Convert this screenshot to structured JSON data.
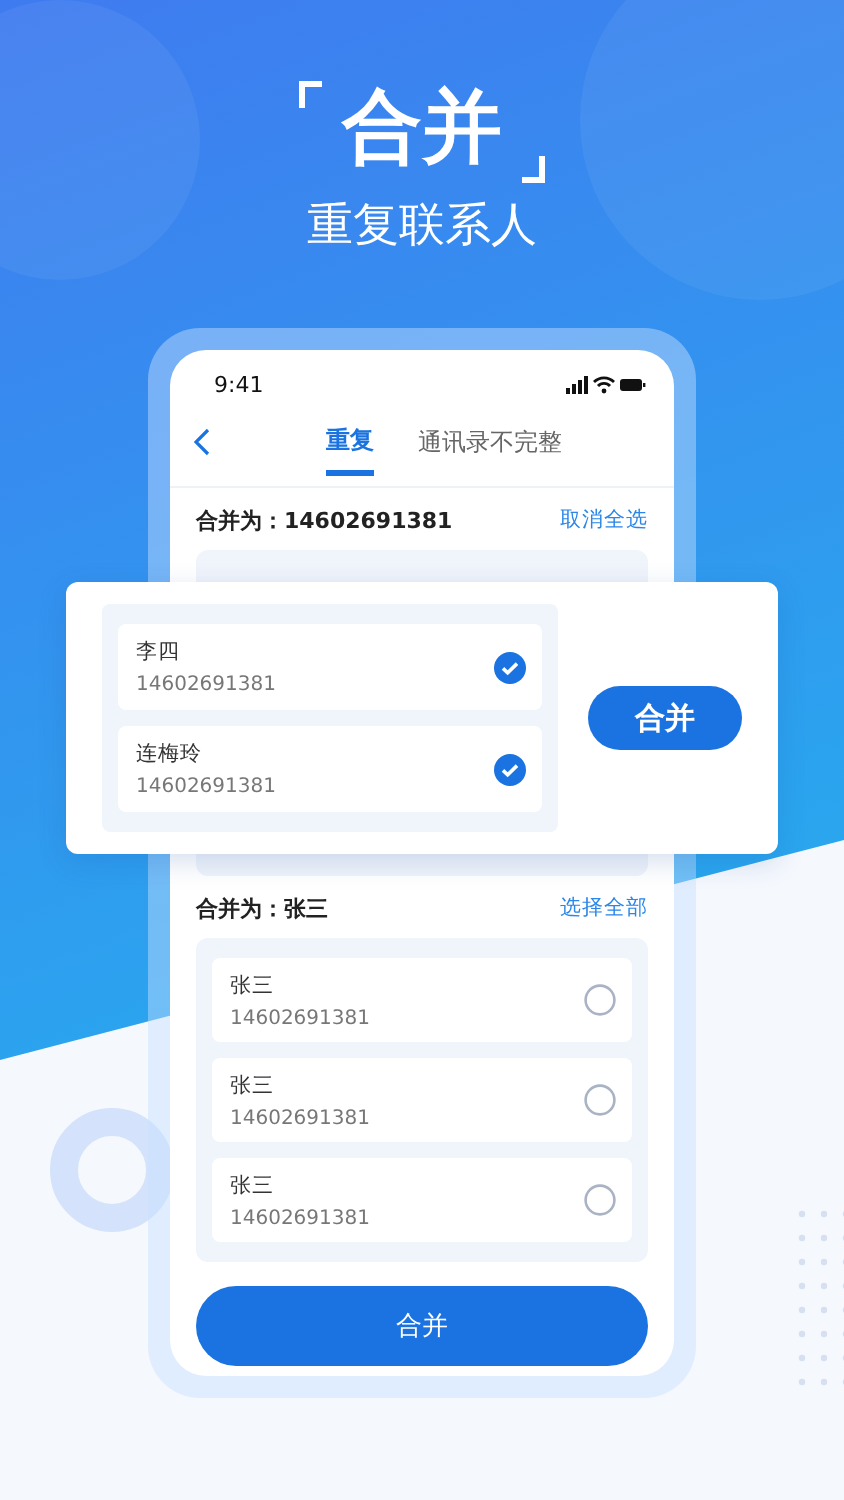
{
  "headline": {
    "title": "合并",
    "subtitle": "重复联系人"
  },
  "status_bar": {
    "time": "9:41"
  },
  "tabs": [
    {
      "label": "重复",
      "selected": true
    },
    {
      "label": "通讯录不完整",
      "selected": false
    }
  ],
  "groups": [
    {
      "heading": "合并为：14602691381",
      "action": "取消全选"
    },
    {
      "heading": "合并为：张三",
      "action": "选择全部",
      "contacts": [
        {
          "name": "张三",
          "phone": "14602691381",
          "checked": false
        },
        {
          "name": "张三",
          "phone": "14602691381",
          "checked": false
        },
        {
          "name": "张三",
          "phone": "14602691381",
          "checked": false
        }
      ]
    }
  ],
  "popup": {
    "contacts": [
      {
        "name": "李四",
        "phone": "14602691381",
        "checked": true
      },
      {
        "name": "连梅玲",
        "phone": "14602691381",
        "checked": true
      }
    ],
    "button": "合并"
  },
  "merge_button": "合并"
}
